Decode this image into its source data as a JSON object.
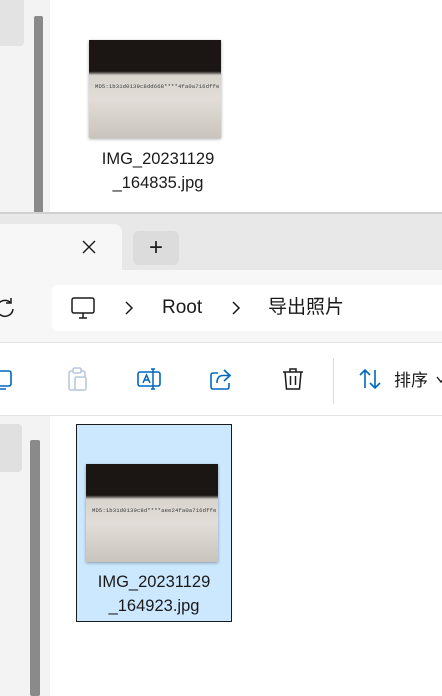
{
  "top_window": {
    "file": {
      "name_line1": "IMG_20231129",
      "name_line2": "_164835.jpg",
      "thumbnail_text": "MD5:1b31d0139c8dd668****4fa0a716dffe"
    }
  },
  "tabs": {
    "close_icon": "close-icon",
    "new_tab_label": "+"
  },
  "address_bar": {
    "breadcrumbs": [
      "Root",
      "导出照片"
    ]
  },
  "toolbar": {
    "sort_label": "排序"
  },
  "main": {
    "file": {
      "name_line1": "IMG_20231129",
      "name_line2": "_164923.jpg",
      "thumbnail_text": "MD5:1b31d0139c8d****aee24fa0a716dffe"
    }
  },
  "colors": {
    "selection_background": "#cce8ff",
    "accent_blue": "#0067c0"
  }
}
